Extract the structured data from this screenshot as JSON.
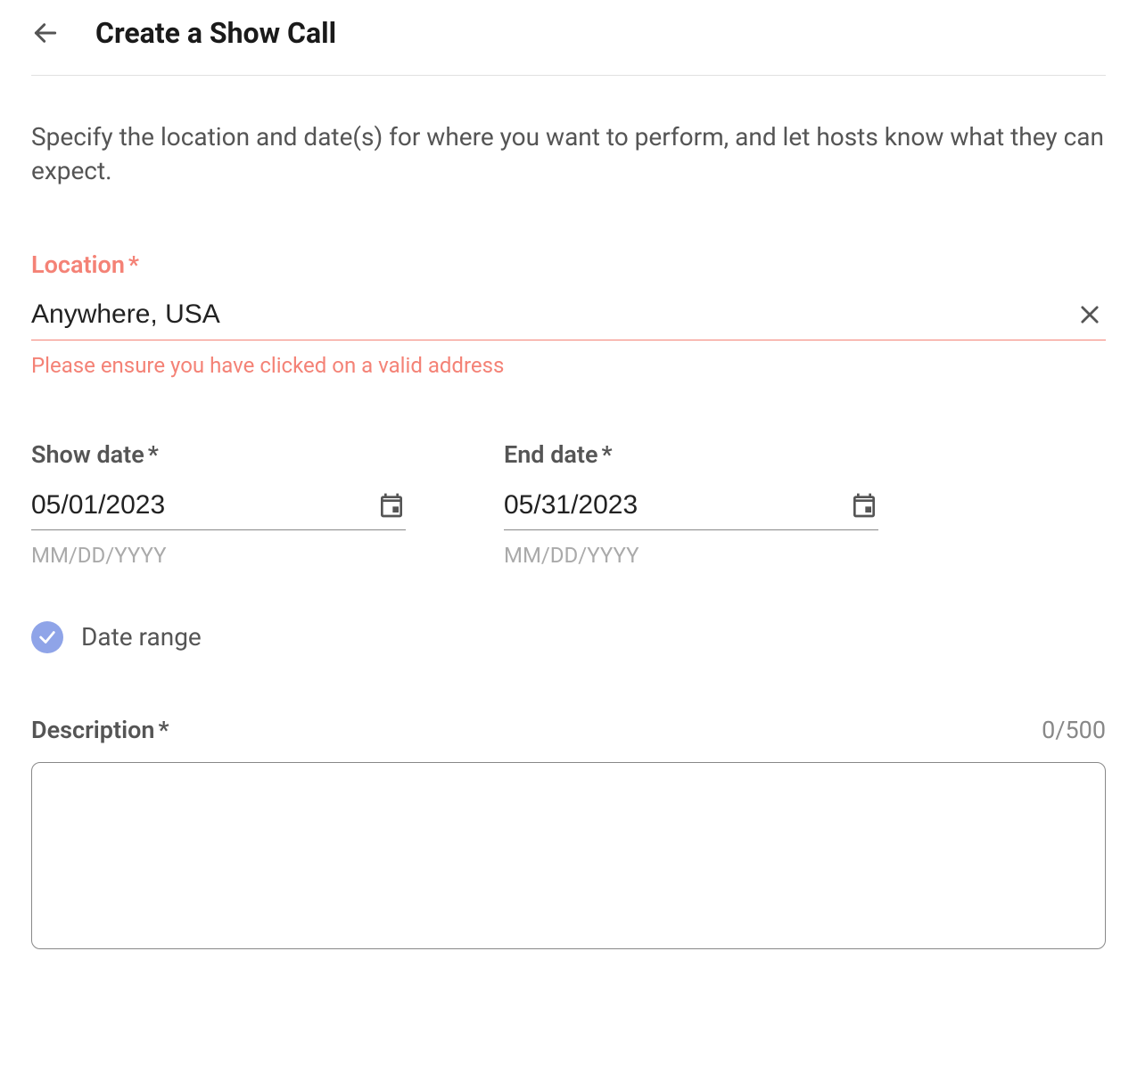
{
  "header": {
    "title": "Create a Show Call"
  },
  "intro": "Specify the location and date(s) for where you want to perform, and let hosts know what they can expect.",
  "location": {
    "label": "Location",
    "required": "*",
    "value": "Anywhere, USA",
    "error": "Please ensure you have clicked on a valid address"
  },
  "show_date": {
    "label": "Show date",
    "required": "*",
    "value": "05/01/2023",
    "hint": "MM/DD/YYYY"
  },
  "end_date": {
    "label": "End date",
    "required": "*",
    "value": "05/31/2023",
    "hint": "MM/DD/YYYY"
  },
  "date_range": {
    "label": "Date range",
    "checked": true
  },
  "description": {
    "label": "Description",
    "required": "*",
    "counter": "0/500",
    "value": ""
  }
}
